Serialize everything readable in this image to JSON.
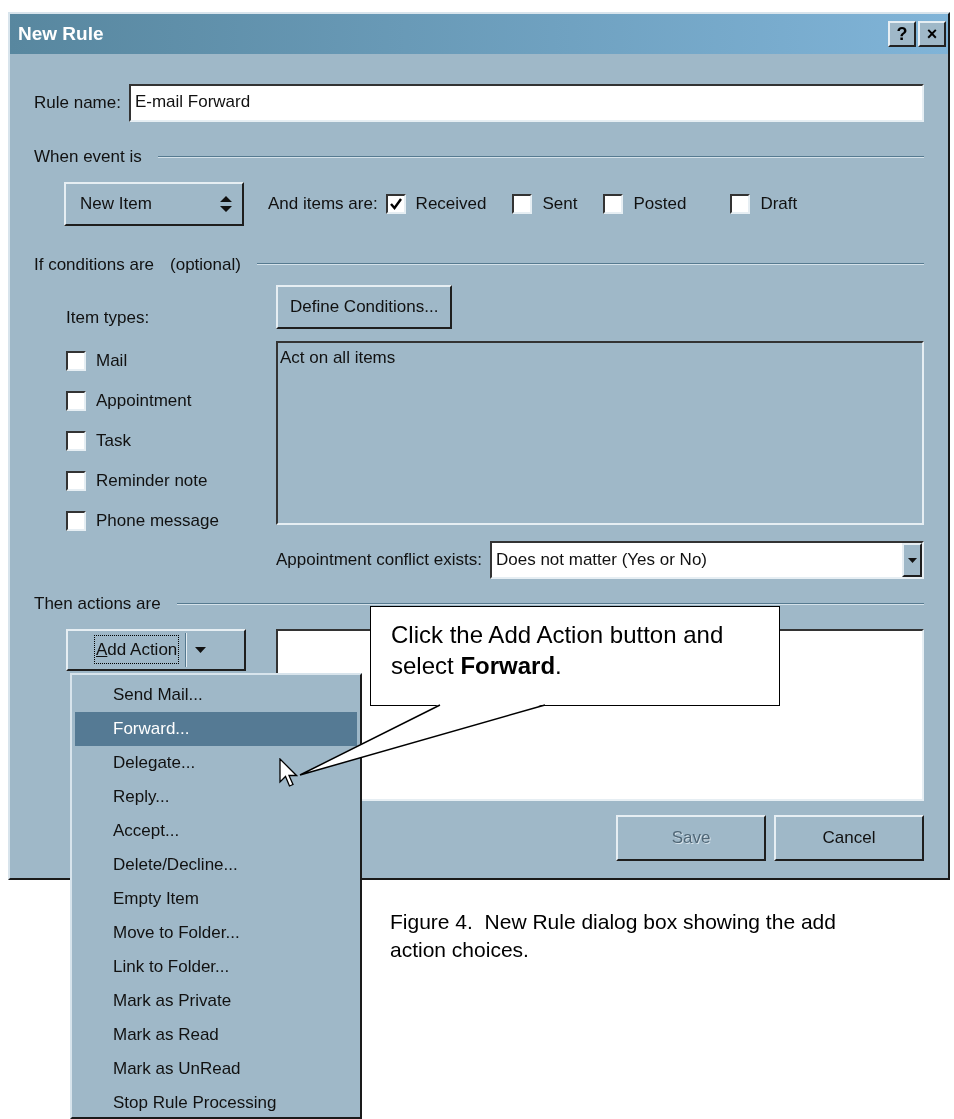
{
  "window": {
    "title": "New Rule",
    "title_buttons": [
      "?",
      "×"
    ]
  },
  "rule_name": {
    "label": "Rule name:",
    "value": "E-mail Forward"
  },
  "when_event": {
    "heading": "When event is",
    "event_value": "New Item",
    "items_label": "And items are:",
    "filters": [
      {
        "label": "Received",
        "checked": true
      },
      {
        "label": "Sent",
        "checked": false
      },
      {
        "label": "Posted",
        "checked": false
      },
      {
        "label": "Draft",
        "checked": false
      }
    ]
  },
  "conditions": {
    "heading": "If conditions are",
    "note": "(optional)",
    "item_types_label": "Item types:",
    "item_types": [
      {
        "label": "Mail",
        "checked": false
      },
      {
        "label": "Appointment",
        "checked": false
      },
      {
        "label": "Task",
        "checked": false
      },
      {
        "label": "Reminder note",
        "checked": false
      },
      {
        "label": "Phone message",
        "checked": false
      }
    ],
    "define_button": "Define Conditions...",
    "summary": "Act on all items",
    "conflict_label": "Appointment conflict exists:",
    "conflict_value": "Does not matter (Yes or No)"
  },
  "actions": {
    "heading": "Then actions are",
    "add_button": "Add Action",
    "menu": [
      {
        "label": "Send Mail...",
        "selected": false
      },
      {
        "label": "Forward...",
        "selected": true
      },
      {
        "label": "Delegate...",
        "selected": false
      },
      {
        "label": "Reply...",
        "selected": false
      },
      {
        "label": "Accept...",
        "selected": false
      },
      {
        "label": "Delete/Decline...",
        "selected": false
      },
      {
        "label": "Empty Item",
        "selected": false
      },
      {
        "label": "Move to Folder...",
        "selected": false
      },
      {
        "label": "Link to Folder...",
        "selected": false
      },
      {
        "label": "Mark as Private",
        "selected": false
      },
      {
        "label": "Mark as Read",
        "selected": false
      },
      {
        "label": "Mark as UnRead",
        "selected": false
      },
      {
        "label": "Stop Rule Processing",
        "selected": false
      }
    ]
  },
  "buttons": [
    {
      "label": "Save",
      "disabled": true
    },
    {
      "label": "Cancel",
      "disabled": false
    }
  ],
  "callout": "Click the Add Action button and select **Forward**.",
  "caption": "Figure 4.  New Rule dialog box showing the add action choices."
}
